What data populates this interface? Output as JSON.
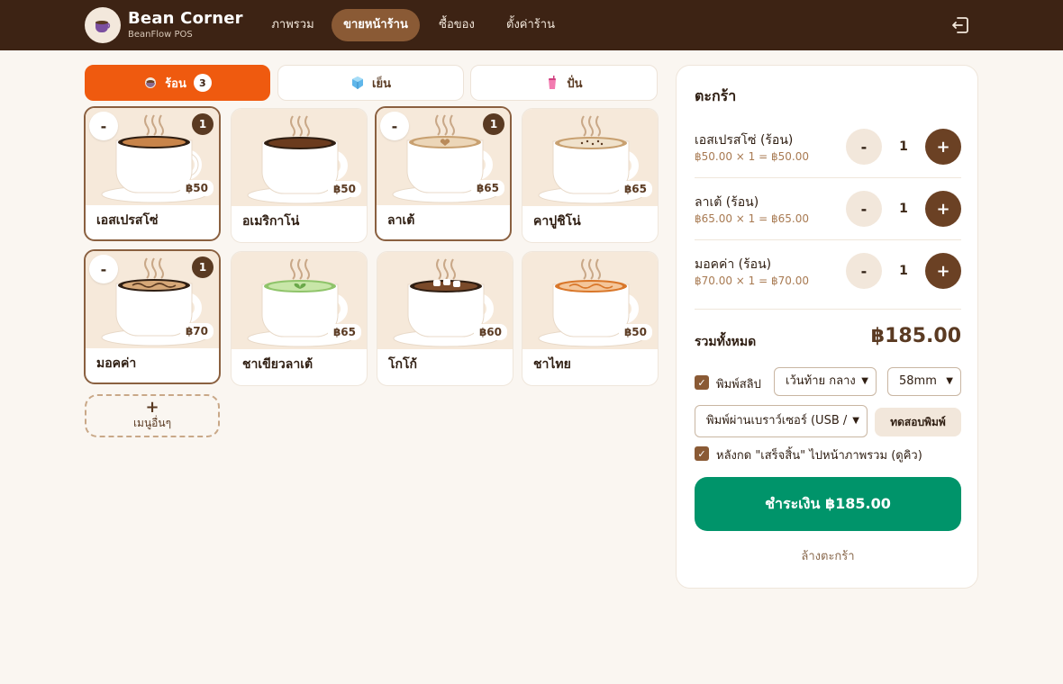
{
  "brand": {
    "name": "Bean Corner",
    "subtitle": "BeanFlow POS"
  },
  "nav": [
    {
      "label": "ภาพรวม"
    },
    {
      "label": "ขายหน้าร้าน"
    },
    {
      "label": "ซื้อของ"
    },
    {
      "label": "ตั้งค่าร้าน"
    }
  ],
  "categories": [
    {
      "label": "ร้อน",
      "badge": "3",
      "icon": "hot-drink-icon"
    },
    {
      "label": "เย็น",
      "icon": "ice-cube-icon"
    },
    {
      "label": "ปั่น",
      "icon": "smoothie-icon"
    }
  ],
  "products": [
    {
      "name": "เอสเปรสโซ่",
      "price": "฿50",
      "qty": "1",
      "minus": "-"
    },
    {
      "name": "อเมริกาโน่",
      "price": "฿50"
    },
    {
      "name": "ลาเต้",
      "price": "฿65",
      "qty": "1",
      "minus": "-"
    },
    {
      "name": "คาปูชิโน่",
      "price": "฿65"
    },
    {
      "name": "มอคค่า",
      "price": "฿70",
      "qty": "1",
      "minus": "-"
    },
    {
      "name": "ชาเขียวลาเต้",
      "price": "฿65"
    },
    {
      "name": "โกโก้",
      "price": "฿60"
    },
    {
      "name": "ชาไทย",
      "price": "฿50"
    }
  ],
  "other_menu": {
    "plus": "+",
    "label": "เมนูอื่นๆ"
  },
  "cart": {
    "title": "ตะกร้า",
    "items": [
      {
        "name": "เอสเปรสโซ่ (ร้อน)",
        "calc": "฿50.00 × 1 = ฿50.00",
        "qty": "1",
        "minus": "-",
        "plus": "+"
      },
      {
        "name": "ลาเต้ (ร้อน)",
        "calc": "฿65.00 × 1 = ฿65.00",
        "qty": "1",
        "minus": "-",
        "plus": "+"
      },
      {
        "name": "มอคค่า (ร้อน)",
        "calc": "฿70.00 × 1 = ฿70.00",
        "qty": "1",
        "minus": "-",
        "plus": "+"
      }
    ],
    "total_label": "รวมทั้งหมด",
    "total_value": "฿185.00",
    "print_slip_label": "พิมพ์สลิป",
    "margin_select": "เว้นท้าย กลาง",
    "paper_select": "58mm",
    "printer_select": "พิมพ์ผ่านเบราว์เซอร์ (USB /",
    "test_print": "ทดสอบพิมพ์",
    "after_finish_label": "หลังกด \"เสร็จสิ้น\" ไปหน้าภาพรวม (ดูคิว)",
    "pay_button": "ชำระเงิน ฿185.00",
    "clear_link": "ล้างตะกร้า"
  },
  "colors": {
    "header_bg": "#3d2314",
    "nav_active": "#8a5a35",
    "tab_active": "#ef5a0f",
    "pay_button": "#00946a",
    "plus_button": "#6b4124"
  }
}
